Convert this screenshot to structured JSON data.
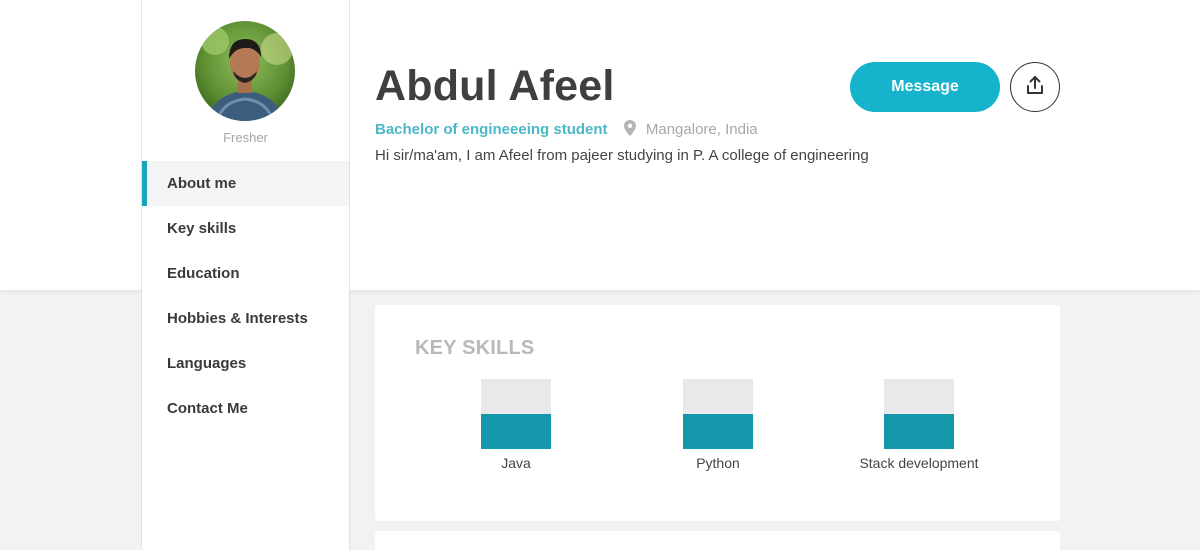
{
  "profile": {
    "name": "Abdul Afeel",
    "role": "Fresher",
    "degree": "Bachelor of engineeeing student",
    "location": "Mangalore, India",
    "bio": "Hi sir/ma'am, I am Afeel from pajeer studying in P. A college of engineering"
  },
  "actions": {
    "message_label": "Message",
    "share_icon": "share-upload-icon"
  },
  "sidebar": {
    "items": [
      {
        "label": "About me",
        "active": true
      },
      {
        "label": "Key skills",
        "active": false
      },
      {
        "label": "Education",
        "active": false
      },
      {
        "label": "Hobbies & Interests",
        "active": false
      },
      {
        "label": "Languages",
        "active": false
      },
      {
        "label": "Contact Me",
        "active": false
      }
    ]
  },
  "key_skills": {
    "title": "KEY SKILLS",
    "skills": [
      {
        "name": "Java",
        "level": 0.5
      },
      {
        "name": "Python",
        "level": 0.5
      },
      {
        "name": "Stack development",
        "level": 0.5
      }
    ]
  },
  "colors": {
    "accent": "#16b3cd",
    "skill_fill": "#1497ab",
    "degree_text": "#4bb8c7"
  }
}
